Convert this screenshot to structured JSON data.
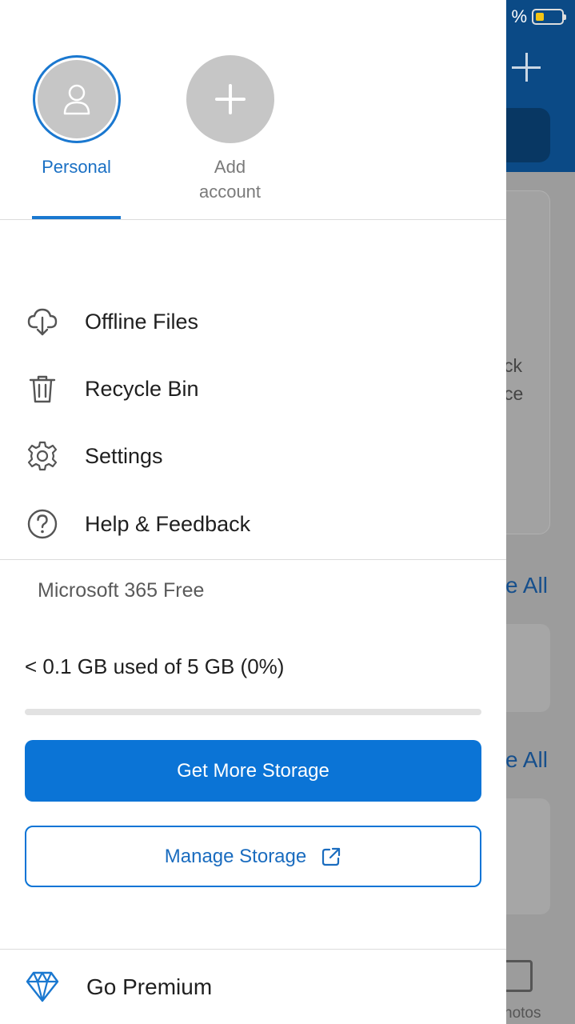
{
  "background_app": {
    "status_percent": "%",
    "card_text_line1": "ck",
    "card_text_line2": "ce",
    "see_all_1": "e All",
    "see_all_2": "e All",
    "photos_tab_label": "hotos"
  },
  "accounts": [
    {
      "label": "Personal",
      "selected": true,
      "icon": "person-icon"
    },
    {
      "label": "Add account",
      "label_line1": "Add",
      "label_line2": "account",
      "selected": false,
      "icon": "plus-icon"
    }
  ],
  "menu": {
    "items": [
      {
        "label": "Offline Files",
        "icon": "cloud-download-icon"
      },
      {
        "label": "Recycle Bin",
        "icon": "trash-icon"
      },
      {
        "label": "Settings",
        "icon": "gear-icon"
      },
      {
        "label": "Help & Feedback",
        "icon": "help-circle-icon"
      }
    ]
  },
  "storage": {
    "plan": "Microsoft 365 Free",
    "usage_text": "< 0.1 GB used of 5 GB (0%)",
    "used_percent": 0,
    "get_more_label": "Get More Storage",
    "manage_label": "Manage Storage"
  },
  "premium": {
    "label": "Go Premium",
    "icon": "diamond-icon"
  },
  "colors": {
    "accent": "#0b74d6",
    "accent_text": "#1a70c4",
    "header_bg": "#0b4a86"
  }
}
